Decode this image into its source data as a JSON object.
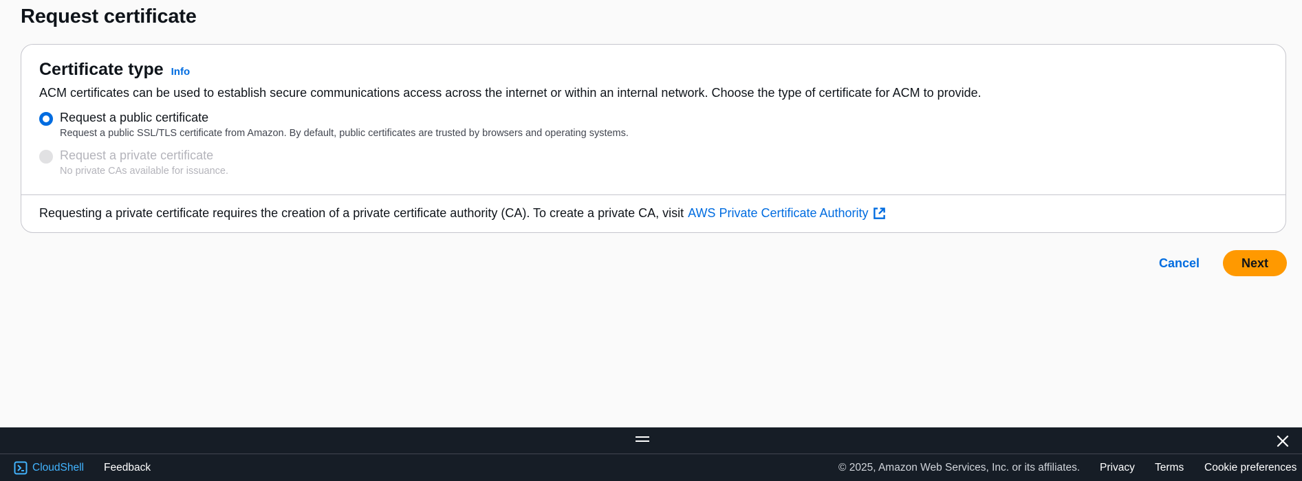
{
  "page": {
    "title": "Request certificate"
  },
  "card": {
    "title": "Certificate type",
    "info_label": "Info",
    "description": "ACM certificates can be used to establish secure communications access across the internet or within an internal network. Choose the type of certificate for ACM to provide.",
    "options": [
      {
        "label": "Request a public certificate",
        "description": "Request a public SSL/TLS certificate from Amazon. By default, public certificates are trusted by browsers and operating systems.",
        "selected": true,
        "disabled": false
      },
      {
        "label": "Request a private certificate",
        "description": "No private CAs available for issuance.",
        "selected": false,
        "disabled": true
      }
    ],
    "footer_text": "Requesting a private certificate requires the creation of a private certificate authority (CA). To create a private CA, visit",
    "footer_link": "AWS Private Certificate Authority"
  },
  "actions": {
    "cancel_label": "Cancel",
    "next_label": "Next"
  },
  "footer": {
    "cloudshell_label": "CloudShell",
    "feedback_label": "Feedback",
    "copyright": "© 2025, Amazon Web Services, Inc. or its affiliates.",
    "privacy_label": "Privacy",
    "terms_label": "Terms",
    "cookie_label": "Cookie preferences"
  },
  "colors": {
    "accent": "#006ce0",
    "primary_button": "#ff9900",
    "footer_bg": "#161d26",
    "cloudshell_link": "#42b4ff"
  },
  "icons": [
    "external-link-icon",
    "cloudshell-icon",
    "drag-handle-icon",
    "close-icon"
  ]
}
